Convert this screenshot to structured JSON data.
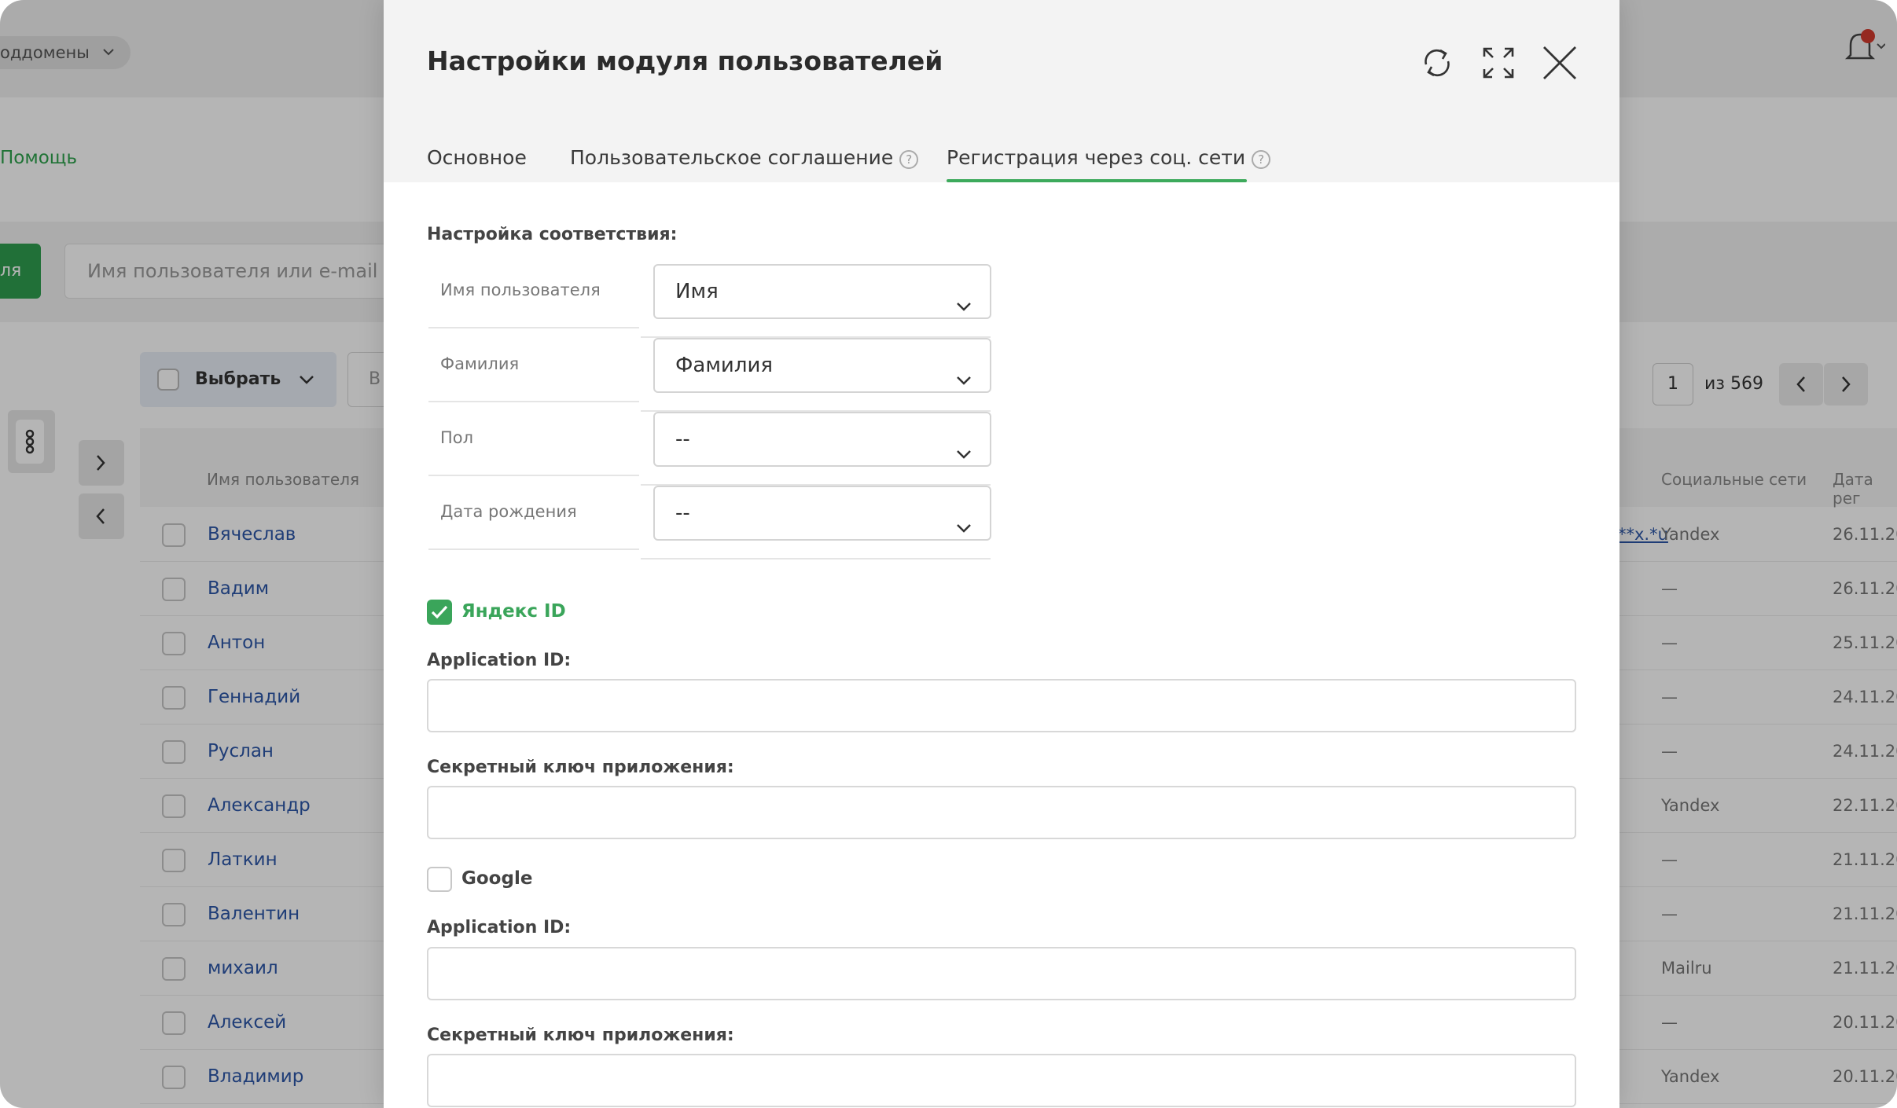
{
  "colors": {
    "accent_green": "#3aa55a",
    "link_blue": "#2d57a8",
    "overlay": "rgba(0,0,0,0.29)"
  },
  "background": {
    "subdomains_label": "оддомены",
    "help_link": "Помощь",
    "add_button_label": "ля",
    "search_placeholder": "Имя пользователя или e-mail",
    "select_label": "Выбрать",
    "b_label": "В",
    "pagination": {
      "current": "1",
      "of_label": "из 569"
    },
    "columns": {
      "username": "Имя пользователя",
      "social": "Социальные сети",
      "date": "Дата рег"
    },
    "rows": [
      {
        "name": "Вячеслав",
        "link": "**x.*u",
        "social": "Yandex",
        "date": "26.11.202"
      },
      {
        "name": "Вадим",
        "social": "—",
        "date": "26.11.202"
      },
      {
        "name": "Антон",
        "social": "—",
        "date": "25.11.202"
      },
      {
        "name": "Геннадий",
        "social": "—",
        "date": "24.11.202"
      },
      {
        "name": "Руслан",
        "social": "—",
        "date": "24.11.202"
      },
      {
        "name": "Александр",
        "social": "Yandex",
        "date": "22.11.202"
      },
      {
        "name": "Латкин",
        "social": "—",
        "date": "21.11.202"
      },
      {
        "name": "Валентин",
        "social": "—",
        "date": "21.11.202"
      },
      {
        "name": "михаил",
        "social": "Mailru",
        "date": "21.11.202"
      },
      {
        "name": "Алексей",
        "social": "—",
        "date": "20.11.202"
      },
      {
        "name": "Владимир",
        "social": "Yandex",
        "date": "20.11.202"
      }
    ]
  },
  "modal": {
    "title": "Настройки модуля пользователей",
    "icons": [
      "refresh-icon",
      "fullscreen-icon",
      "close-icon"
    ],
    "tabs": [
      {
        "label": "Основное",
        "help": false,
        "active": false
      },
      {
        "label": "Пользовательское соглашение",
        "help": true,
        "active": false
      },
      {
        "label": "Регистрация через соц. сети",
        "help": true,
        "active": true
      }
    ],
    "help_glyph": "?",
    "mapping": {
      "title": "Настройка соответствия:",
      "rows": [
        {
          "label": "Имя пользователя",
          "value": "Имя"
        },
        {
          "label": "Фамилия",
          "value": "Фамилия"
        },
        {
          "label": "Пол",
          "value": "--"
        },
        {
          "label": "Дата рождения",
          "value": "--"
        }
      ]
    },
    "providers": [
      {
        "name": "Яндекс ID",
        "enabled": true,
        "app_id_label": "Application ID:",
        "app_id_value": "",
        "secret_label": "Секретный ключ приложения:",
        "secret_value": ""
      },
      {
        "name": "Google",
        "enabled": false,
        "app_id_label": "Application ID:",
        "app_id_value": "",
        "secret_label": "Секретный ключ приложения:",
        "secret_value": ""
      }
    ]
  }
}
